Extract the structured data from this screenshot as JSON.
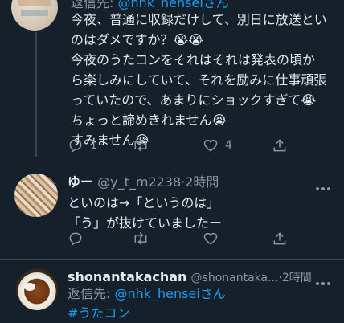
{
  "tweet1": {
    "reply_prefix": "返信先: ",
    "reply_to": "@nhk_henseiさん",
    "lines": [
      "今夜、普通に収録だけして、別日に放送とい",
      "のはダメですか？😭😭",
      "今夜のうたコンをそれはそれは発表の頃か",
      "ら楽しみにしていて、それを励みに仕事頑張",
      "っていたので、あまりにショックすぎて😭",
      "ちょっと諦めきれません😭",
      "すみません😭"
    ],
    "actions": {
      "reply_count": "1",
      "retweet_count": "",
      "like_count": "4"
    }
  },
  "tweet2": {
    "display_name": "ゆー",
    "handle": "@y_t_m2238",
    "time": "·2時間",
    "lines": [
      "といのは→「というのは」",
      "「う」が抜けていましたー"
    ]
  },
  "tweet3": {
    "display_name": "shonantakachan",
    "handle": "@shonantaka...",
    "time": "·2時間",
    "reply_prefix": "返信先: ",
    "reply_to": "@nhk_henseiさん",
    "hashtag": "#うたコン"
  },
  "colors": {
    "background": "#15202b",
    "text": "#e7e9ea",
    "muted": "#8b98a5",
    "accent": "#1d9bf0"
  },
  "icons": [
    "reply-icon",
    "retweet-icon",
    "like-icon",
    "share-icon",
    "more-icon"
  ]
}
